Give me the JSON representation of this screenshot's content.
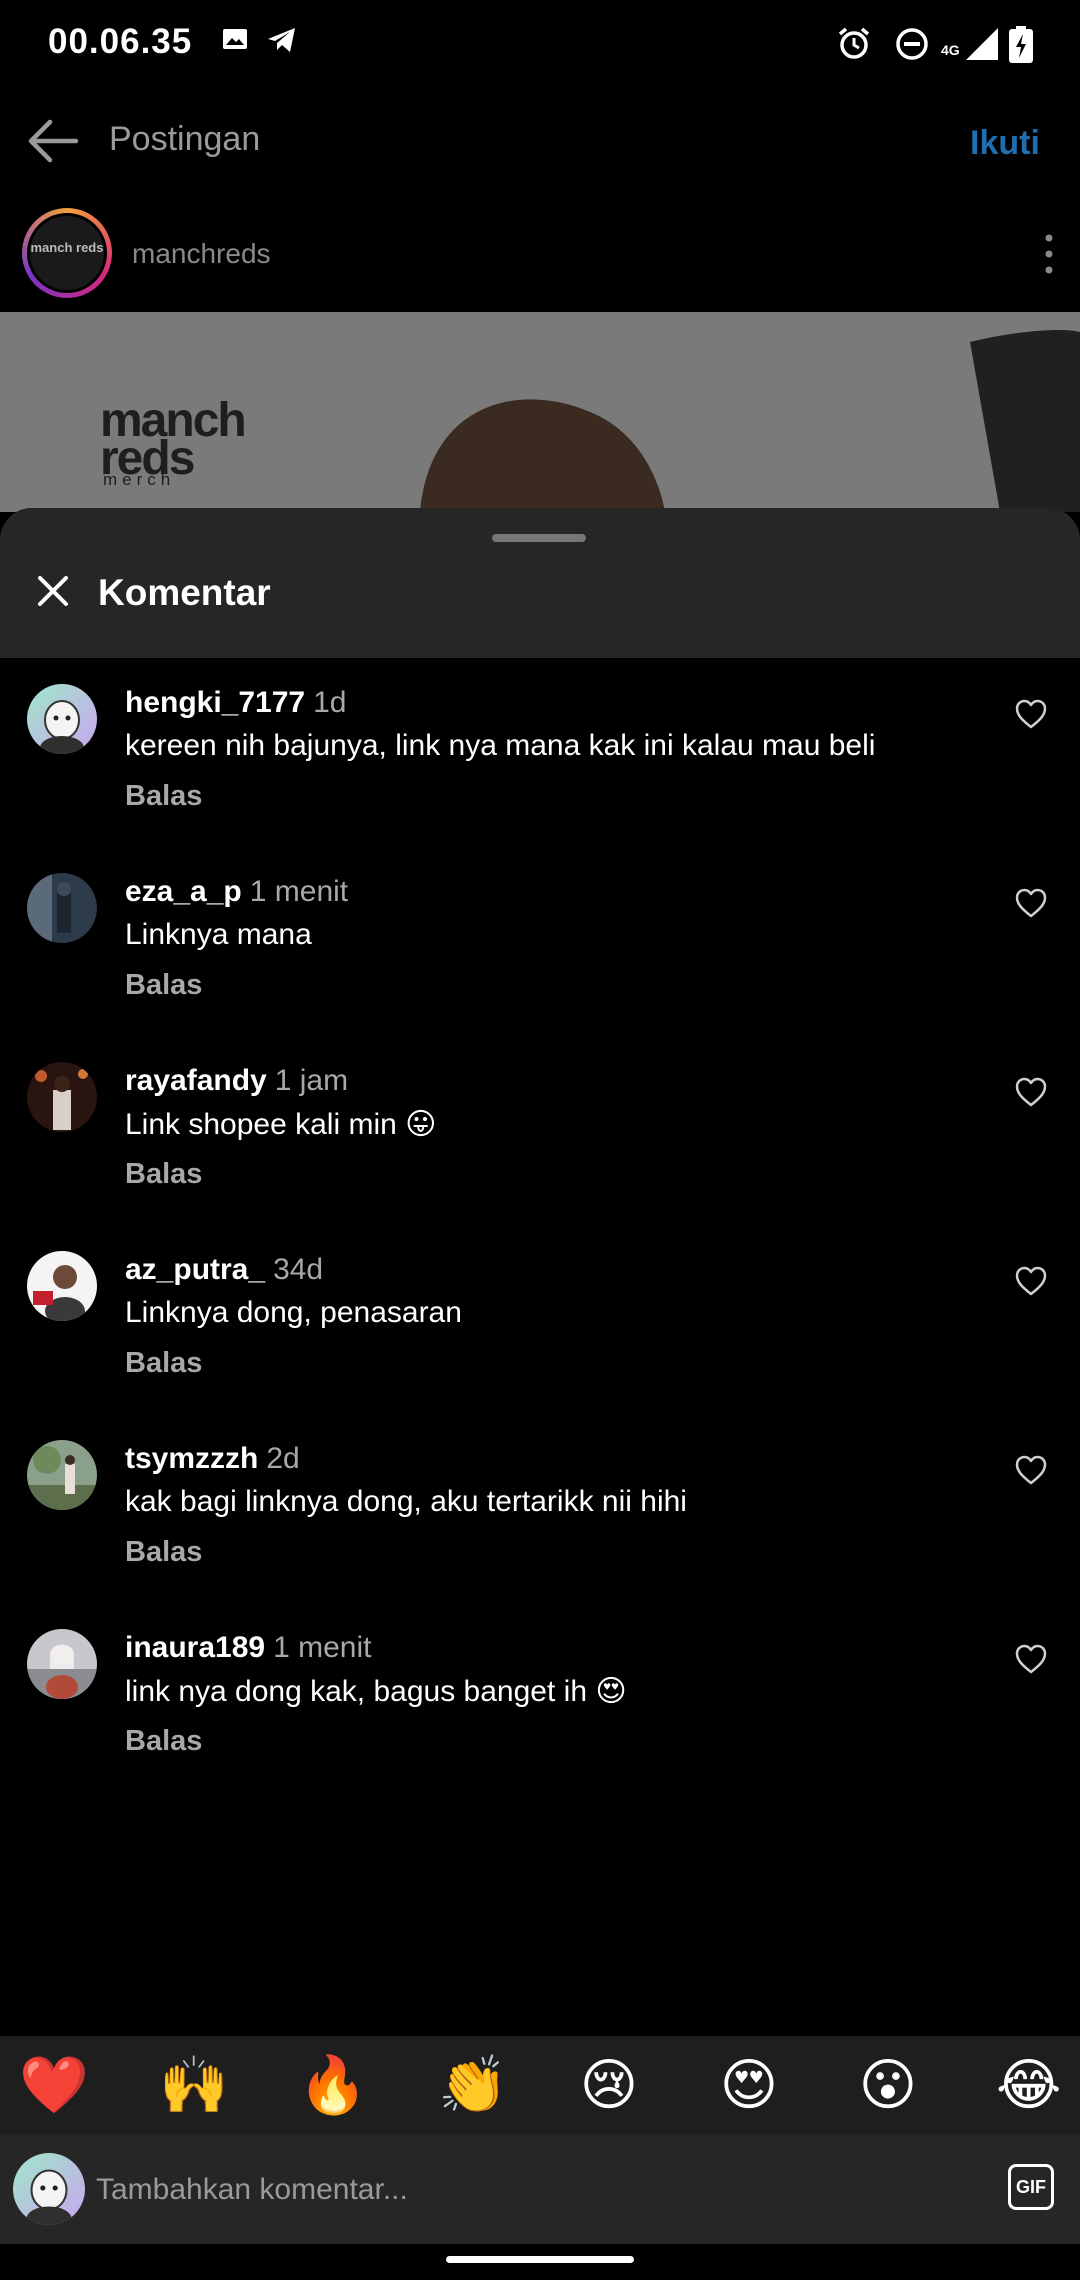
{
  "status_bar": {
    "time": "00.06.35",
    "network": "4G"
  },
  "header": {
    "title": "Postingan",
    "follow_label": "Ikuti"
  },
  "post": {
    "author": "manchreds",
    "author_avatar_text": "manch reds",
    "brand_logo": "manch reds",
    "brand_sub": "merch"
  },
  "sheet": {
    "title": "Komentar",
    "comments": [
      {
        "user": "hengki_7177",
        "time": "1d",
        "text": "kereen nih bajunya, link nya mana kak ini kalau mau beli",
        "reply": "Balas"
      },
      {
        "user": "eza_a_p",
        "time": "1 menit",
        "text": "Linknya mana",
        "reply": "Balas"
      },
      {
        "user": "rayafandy",
        "time": "1 jam",
        "text": "Link shopee kali min 😛",
        "reply": "Balas"
      },
      {
        "user": "az_putra_",
        "time": "34d",
        "text": "Linknya dong, penasaran",
        "reply": "Balas"
      },
      {
        "user": "tsymzzzh",
        "time": "2d",
        "text": "kak bagi linknya dong, aku tertarikk nii hihi",
        "reply": "Balas"
      },
      {
        "user": "inaura189",
        "time": "1 menit",
        "text": "link nya dong kak, bagus banget ih 😍",
        "reply": "Balas"
      }
    ]
  },
  "emoji_bar": [
    "❤️",
    "🙌",
    "🔥",
    "👏",
    "😢",
    "😍",
    "😮",
    "😂"
  ],
  "input": {
    "placeholder": "Tambahkan komentar...",
    "gif_label": "GIF"
  },
  "colors": {
    "accent": "#1f6fb0",
    "sheet_header": "#262626",
    "muted_text": "#a8a8a8"
  }
}
